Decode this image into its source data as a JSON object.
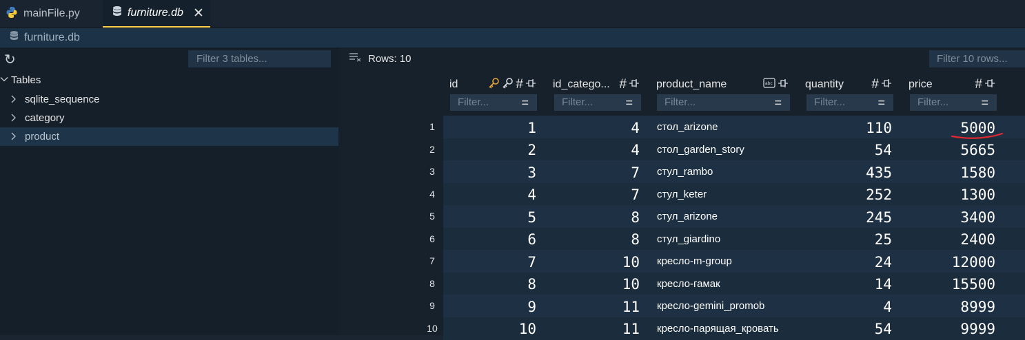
{
  "tabs": [
    {
      "label": "mainFile.py",
      "icon": "python-icon",
      "active": false
    },
    {
      "label": "furniture.db",
      "icon": "database-icon",
      "active": true
    }
  ],
  "breadcrumb": {
    "label": "furniture.db",
    "icon": "database-icon"
  },
  "sidebar": {
    "filter_placeholder": "Filter 3 tables...",
    "root_label": "Tables",
    "items": [
      {
        "label": "sqlite_sequence"
      },
      {
        "label": "category"
      },
      {
        "label": "product"
      }
    ]
  },
  "grid": {
    "rows_label": "Rows: 10",
    "filter_placeholder": "Filter 10 rows...",
    "filter_cell_placeholder": "Filter...",
    "columns": [
      {
        "label": "id",
        "icons": [
          "key-icon",
          "foreign-key-icon",
          "hash-icon",
          "pin-icon"
        ]
      },
      {
        "label": "id_catego...",
        "icons": [
          "hash-icon",
          "pin-icon"
        ]
      },
      {
        "label": "product_name",
        "icons": [
          "text-type-icon",
          "pin-icon"
        ]
      },
      {
        "label": "quantity",
        "icons": [
          "hash-icon",
          "pin-icon"
        ]
      },
      {
        "label": "price",
        "icons": [
          "hash-icon",
          "pin-icon"
        ]
      }
    ],
    "rows": [
      {
        "n": "1",
        "id": "1",
        "cat": "4",
        "name": "стол_arizone",
        "qty": "110",
        "price": "5000"
      },
      {
        "n": "2",
        "id": "2",
        "cat": "4",
        "name": "стол_garden_story",
        "qty": "54",
        "price": "5665"
      },
      {
        "n": "3",
        "id": "3",
        "cat": "7",
        "name": "стул_rambo",
        "qty": "435",
        "price": "1580"
      },
      {
        "n": "4",
        "id": "4",
        "cat": "7",
        "name": "стул_keter",
        "qty": "252",
        "price": "1300"
      },
      {
        "n": "5",
        "id": "5",
        "cat": "8",
        "name": "стул_arizone",
        "qty": "245",
        "price": "3400"
      },
      {
        "n": "6",
        "id": "6",
        "cat": "8",
        "name": "стул_giardino",
        "qty": "25",
        "price": "2400"
      },
      {
        "n": "7",
        "id": "7",
        "cat": "10",
        "name": "кресло-m-group",
        "qty": "24",
        "price": "12000"
      },
      {
        "n": "8",
        "id": "8",
        "cat": "10",
        "name": "кресло-гамак",
        "qty": "14",
        "price": "15500"
      },
      {
        "n": "9",
        "id": "9",
        "cat": "11",
        "name": "кресло-gemini_promob",
        "qty": "4",
        "price": "8999"
      },
      {
        "n": "10",
        "id": "10",
        "cat": "11",
        "name": "кресло-парящая_кровать",
        "qty": "54",
        "price": "9999"
      }
    ]
  },
  "colors": {
    "accent_tab": "#ffd24d",
    "annotation_red": "#e0282e",
    "key_orange": "#e8a23a"
  }
}
